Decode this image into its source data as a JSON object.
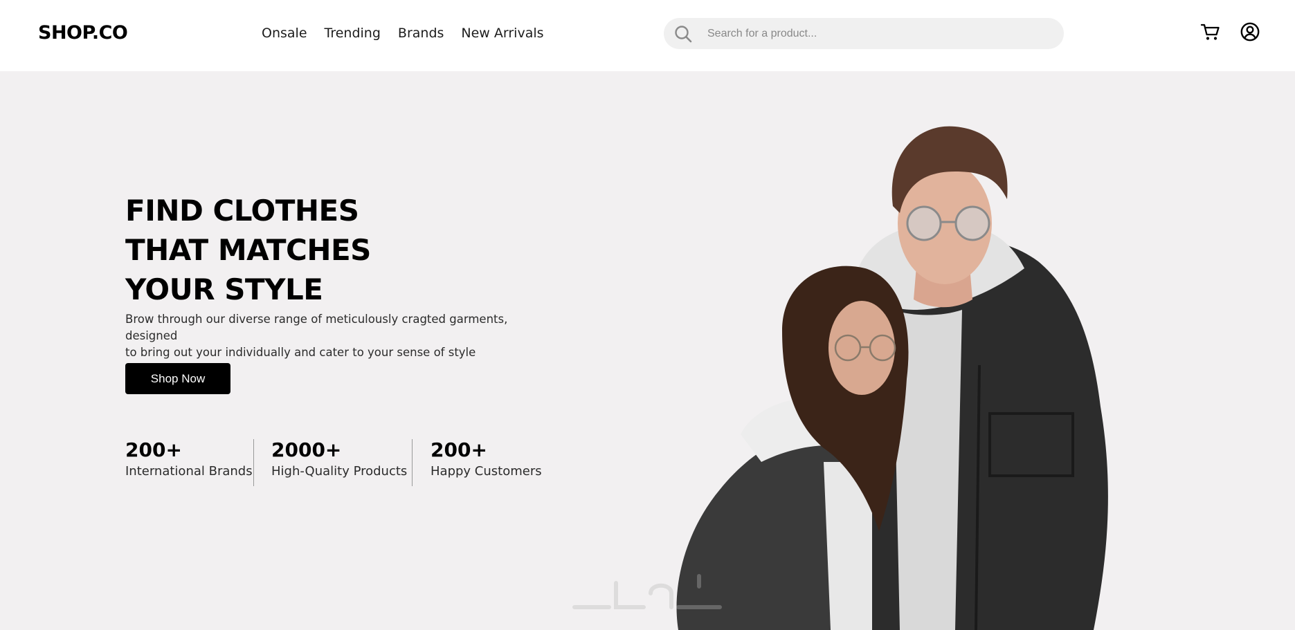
{
  "header": {
    "logo": "SHOP.CO",
    "nav": [
      "Onsale",
      "Trending",
      "Brands",
      "New Arrivals"
    ],
    "search": {
      "placeholder": "Search for a product..."
    },
    "icons": {
      "search": "search-icon",
      "cart": "cart-icon",
      "account": "account-icon"
    }
  },
  "hero": {
    "headline": [
      "FIND CLOTHES",
      "THAT MATCHES",
      "YOUR STYLE"
    ],
    "description_line1": "Brow through our diverse range of meticulously cragted garments, designed",
    "description_line2": "to bring out your individually and cater to your sense of style",
    "cta_label": "Shop Now",
    "stats": [
      {
        "value": "200+",
        "label": "International Brands"
      },
      {
        "value": "2000+",
        "label": "High-Quality Products"
      },
      {
        "value": "200+",
        "label": "Happy Customers"
      }
    ]
  },
  "colors": {
    "hero_background": "#f2f0f1",
    "button_background": "#000000",
    "search_background": "#f0f0f0"
  }
}
